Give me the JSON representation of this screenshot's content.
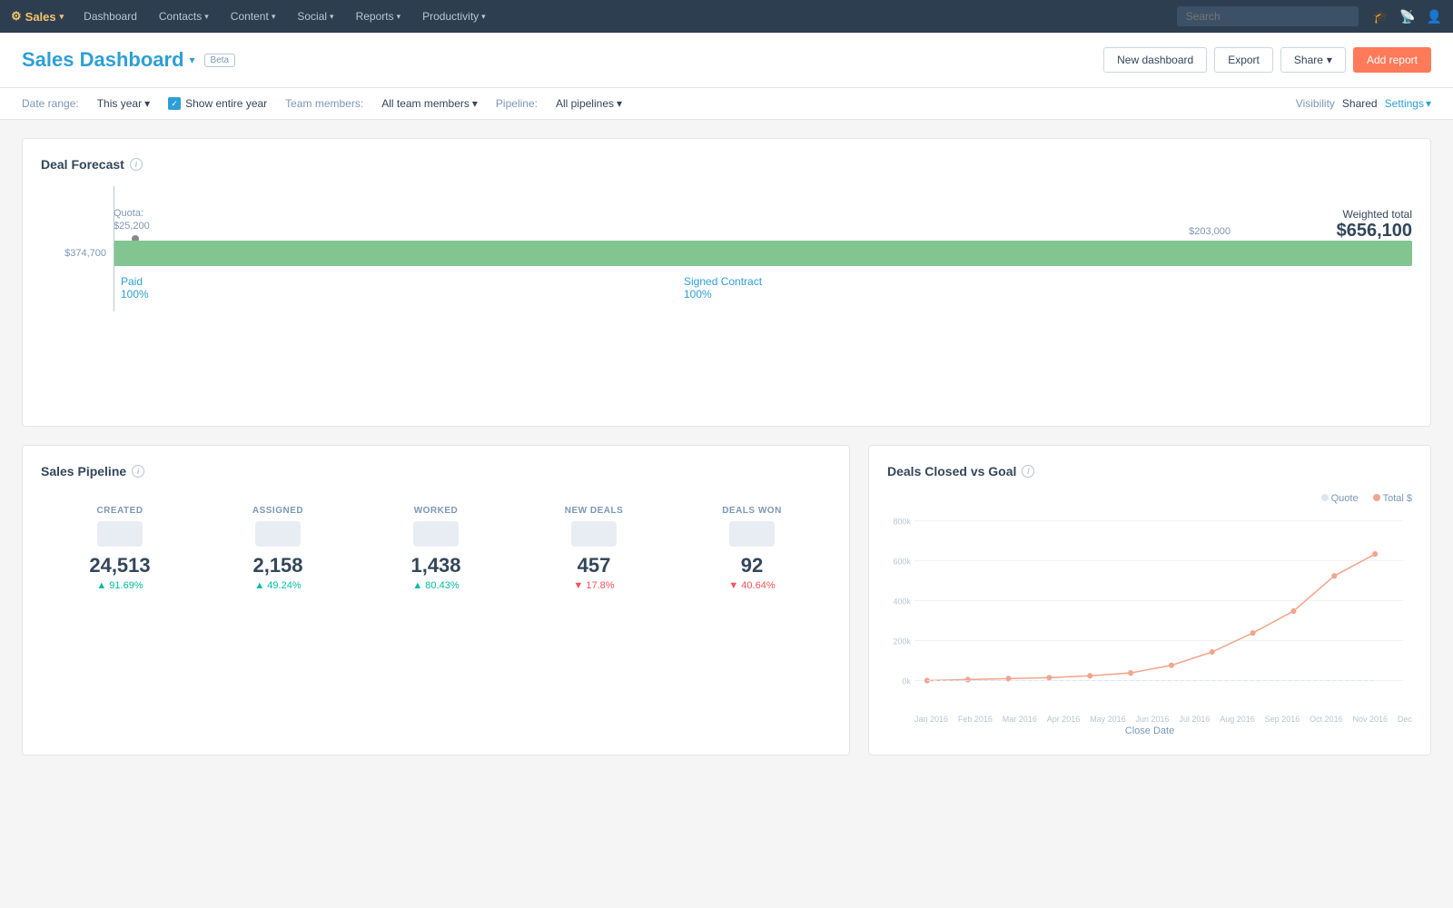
{
  "nav": {
    "brand": "Sales",
    "items": [
      "Dashboard",
      "Contacts",
      "Content",
      "Social",
      "Reports",
      "Productivity"
    ],
    "search_placeholder": "Search"
  },
  "header": {
    "title": "Sales Dashboard",
    "beta_label": "Beta",
    "buttons": {
      "new_dashboard": "New dashboard",
      "export": "Export",
      "share": "Share",
      "add_report": "Add report"
    }
  },
  "filters": {
    "date_range_label": "Date range:",
    "date_range_value": "This year",
    "show_entire_year": "Show entire year",
    "team_members_label": "Team members:",
    "team_members_value": "All team members",
    "pipeline_label": "Pipeline:",
    "pipeline_value": "All pipelines",
    "visibility_label": "Visibility",
    "visibility_value": "Shared",
    "settings": "Settings"
  },
  "deal_forecast": {
    "title": "Deal Forecast",
    "weighted_label": "Weighted total",
    "weighted_value": "$656,100",
    "quota_label": "Quota:",
    "quota_value": "$25,200",
    "bar_left_value": "$374,700",
    "bar_right_value": "$203,000",
    "paid_label": "Paid",
    "paid_pct": "100%",
    "signed_label": "Signed Contract",
    "signed_pct": "100%"
  },
  "sales_pipeline": {
    "title": "Sales Pipeline",
    "metrics": [
      {
        "label": "CREATED",
        "value": "24,513",
        "change": "▲ 91.69%",
        "up": true
      },
      {
        "label": "ASSIGNED",
        "value": "2,158",
        "change": "▲ 49.24%",
        "up": true
      },
      {
        "label": "WORKED",
        "value": "1,438",
        "change": "▲ 80.43%",
        "up": true
      },
      {
        "label": "NEW DEALS",
        "value": "457",
        "change": "▼ 17.8%",
        "up": false
      },
      {
        "label": "DEALS WON",
        "value": "92",
        "change": "▼ 40.64%",
        "up": false
      }
    ]
  },
  "deals_closed": {
    "title": "Deals Closed vs Goal",
    "legend": [
      {
        "label": "Quote",
        "color": "#dde6ee"
      },
      {
        "label": "Total $",
        "color": "#f2a58e"
      }
    ],
    "y_labels": [
      "800k",
      "600k",
      "400k",
      "200k",
      "0k"
    ],
    "x_labels": [
      "Jan 2016",
      "Feb 2016",
      "Mar 2016",
      "Apr 2016",
      "May 2016",
      "Jun 2016",
      "Jul 2016",
      "Aug 2016",
      "Sep 2016",
      "Oct 2016",
      "Nov 2016",
      "Dec"
    ],
    "x_axis_label": "Close Date"
  }
}
